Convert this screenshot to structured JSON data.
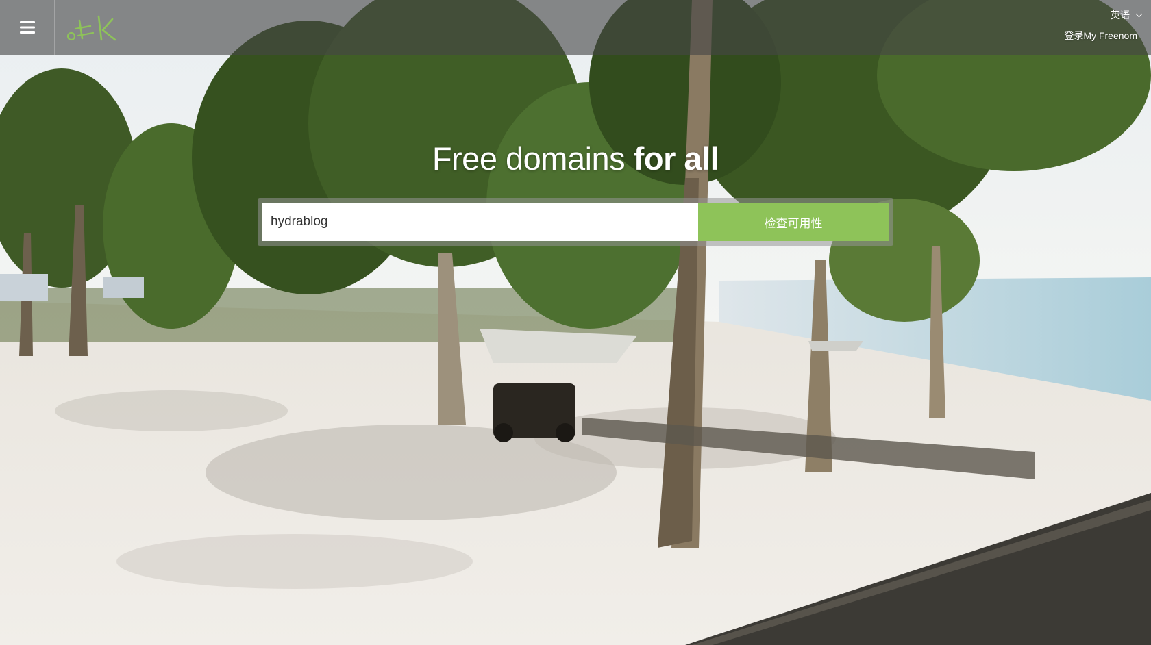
{
  "header": {
    "menu_icon": "hamburger-menu-icon",
    "logo_text": ".tk",
    "language_label": "英语",
    "login_label": "登录My Freenom"
  },
  "hero": {
    "title_light": "Free domains ",
    "title_bold": "for all"
  },
  "search": {
    "value": "hydrablog",
    "button_label": "检查可用性"
  },
  "colors": {
    "accent": "#8ec359",
    "header_bg": "#464646"
  }
}
